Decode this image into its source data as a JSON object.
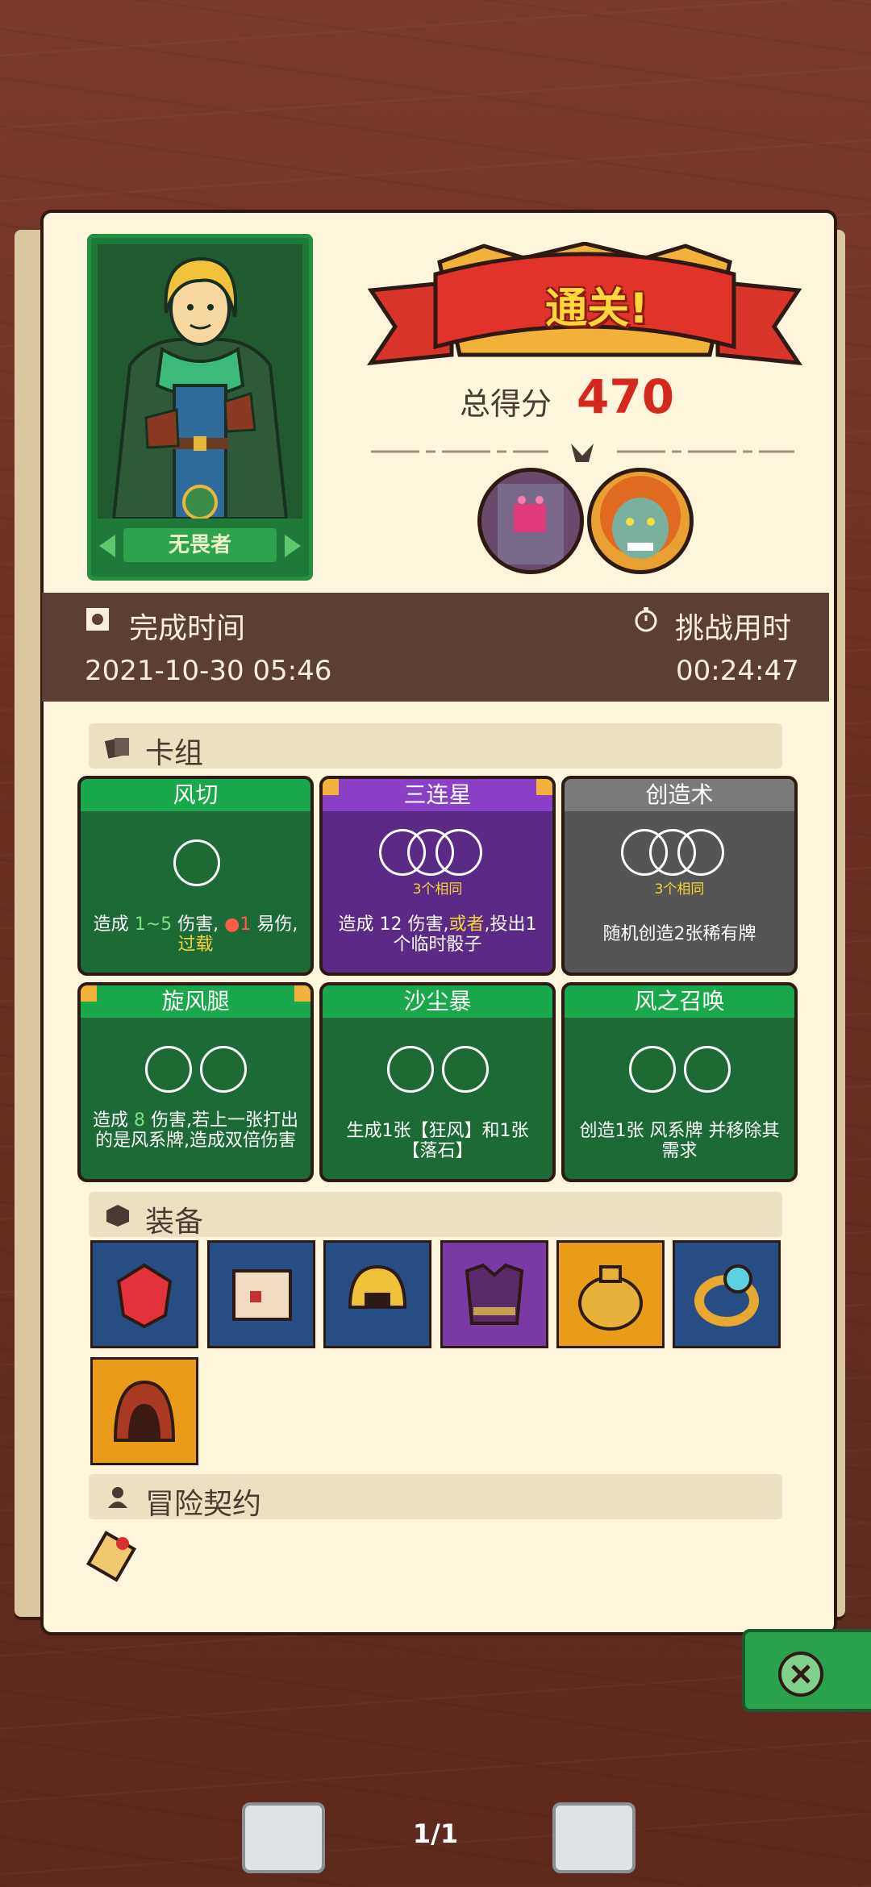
{
  "hero": {
    "name": "无畏者"
  },
  "result": {
    "clear_label": "通关!",
    "score_label": "总得分",
    "score": "470"
  },
  "info": {
    "finish_label": "完成时间",
    "finish_value": "2021-10-30 05:46",
    "challenge_label": "挑战用时",
    "challenge_value": "00:24:47"
  },
  "sections": {
    "deck": "卡组",
    "equipment": "装备",
    "contract": "冒险契约"
  },
  "cards": [
    {
      "title": "风切",
      "desc_parts": [
        "造成",
        "1~5",
        "伤害,",
        "1",
        "易伤,",
        "过载"
      ],
      "type": "green"
    },
    {
      "title": "三连星",
      "sub": "3个相同",
      "desc_parts": [
        "造成",
        "12 伤害,",
        "或者",
        ",投出1个临时骰子"
      ],
      "type": "purple"
    },
    {
      "title": "创造术",
      "sub": "3个相同",
      "desc": "随机创造2张稀有牌",
      "type": "gray"
    },
    {
      "title": "旋风腿",
      "desc_parts": [
        "造成",
        "8",
        "伤害,若上一张打出的是风系牌,造成双倍伤害"
      ],
      "type": "green"
    },
    {
      "title": "沙尘暴",
      "desc": "生成1张【狂风】和1张【落石】",
      "type": "green"
    },
    {
      "title": "风之召唤",
      "desc_parts": [
        "创造1张",
        "风系牌 并移除其需求"
      ],
      "type": "green"
    }
  ],
  "equipment_icons": [
    "ruby-gem-icon",
    "scroll-icon",
    "golden-helmet-icon",
    "purple-armor-icon",
    "treasure-sack-icon",
    "gold-ring-icon",
    "red-hood-icon"
  ],
  "pager": {
    "page": "1/1"
  },
  "colors": {
    "score_red": "#d4271e",
    "card_green": "#19a84a",
    "card_purple": "#8b3fc6",
    "card_gray": "#7a7a7a"
  }
}
